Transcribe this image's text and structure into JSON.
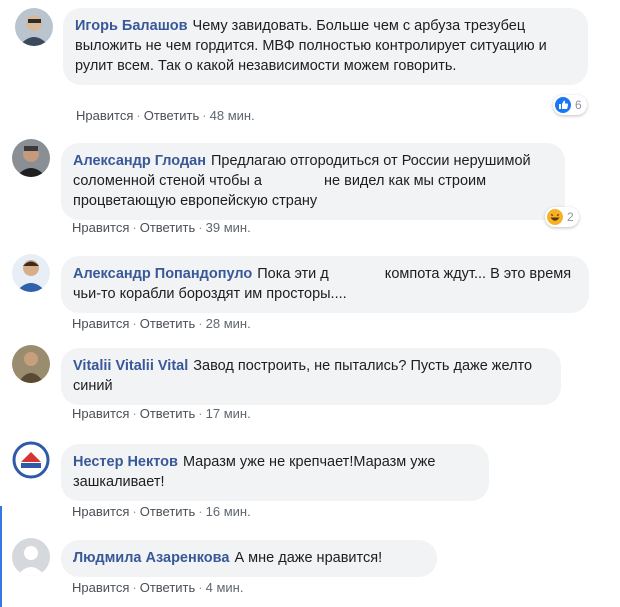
{
  "actions": {
    "like": "Нравится",
    "reply": "Ответить"
  },
  "comments": [
    {
      "author": "Игорь Балашов",
      "text": "Чему завидовать. Больше чем с арбуза трезубец выложить не чем гордится. МВФ полностью контролирует ситуацию и рулит всем. Так о какой независимости можем говорить.",
      "time": "48 мин.",
      "reaction_icon": "like-icon",
      "reaction_count": "6"
    },
    {
      "author": "Александр Глодан",
      "text_before": "Предлагаю отгородиться от России нерушимой соломенной стеной чтобы а",
      "text_after": " не видел как мы строим процветающую европейскую страну",
      "time": "39 мин.",
      "reaction_icon": "haha-icon",
      "reaction_count": "2"
    },
    {
      "author": "Александр Попандопуло",
      "text_before": "Пока эти д",
      "text_after": " компота ждут... В это время чьи-то корабли бороздят им просторы....",
      "time": "28 мин."
    },
    {
      "author": "Vitalii Vitalii Vital",
      "text": "Завод построить, не пытались? Пусть даже желто синий",
      "time": "17 мин."
    },
    {
      "author": "Нестер Нектов",
      "text": "Маразм уже не крепчает!Маразм уже зашкаливает!",
      "time": "16 мин."
    },
    {
      "author": "Людмила Азаренкова",
      "text": "А мне даже нравится!",
      "time": "4 мин."
    }
  ]
}
